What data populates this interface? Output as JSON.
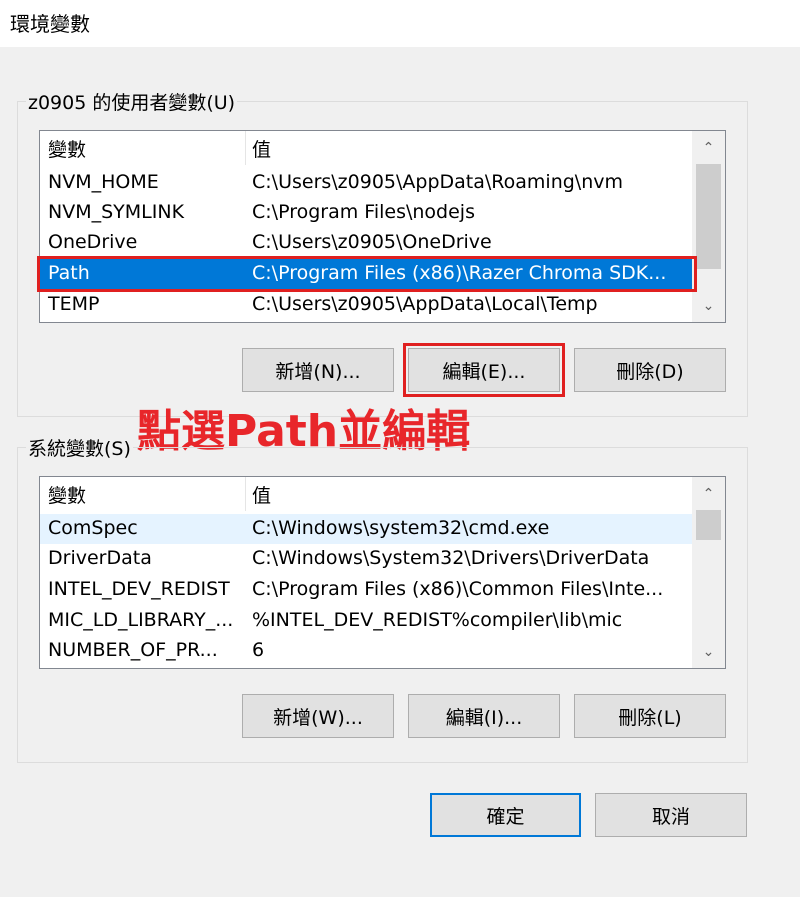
{
  "window": {
    "title": "環境變數"
  },
  "user_vars": {
    "group_label": "z0905 的使用者變數(U)",
    "headers": {
      "name": "變數",
      "value": "值"
    },
    "rows": [
      {
        "name": "NVM_HOME",
        "value": "C:\\Users\\z0905\\AppData\\Roaming\\nvm"
      },
      {
        "name": "NVM_SYMLINK",
        "value": "C:\\Program Files\\nodejs"
      },
      {
        "name": "OneDrive",
        "value": "C:\\Users\\z0905\\OneDrive"
      },
      {
        "name": "Path",
        "value": "C:\\Program Files (x86)\\Razer Chroma SDK..."
      },
      {
        "name": "TEMP",
        "value": "C:\\Users\\z0905\\AppData\\Local\\Temp"
      }
    ],
    "selected_row": "Path",
    "buttons": {
      "new": "新增(N)...",
      "edit": "編輯(E)...",
      "delete": "刪除(D)"
    }
  },
  "system_vars": {
    "group_label": "系統變數(S)",
    "headers": {
      "name": "變數",
      "value": "值"
    },
    "rows": [
      {
        "name": "ComSpec",
        "value": "C:\\Windows\\system32\\cmd.exe"
      },
      {
        "name": "DriverData",
        "value": "C:\\Windows\\System32\\Drivers\\DriverData"
      },
      {
        "name": "INTEL_DEV_REDIST",
        "value": "C:\\Program Files (x86)\\Common Files\\Inte..."
      },
      {
        "name": "MIC_LD_LIBRARY_...",
        "value": "%INTEL_DEV_REDIST%compiler\\lib\\mic"
      },
      {
        "name": "NUMBER_OF_PR...",
        "value": "6"
      }
    ],
    "buttons": {
      "new": "新增(W)...",
      "edit": "編輯(I)...",
      "delete": "刪除(L)"
    }
  },
  "dialog_buttons": {
    "ok": "確定",
    "cancel": "取消"
  },
  "annotation": {
    "text": "點選Path並編輯",
    "color": "#e8262a"
  },
  "colors": {
    "selection": "#0078d7",
    "highlight_box": "#e02020"
  }
}
